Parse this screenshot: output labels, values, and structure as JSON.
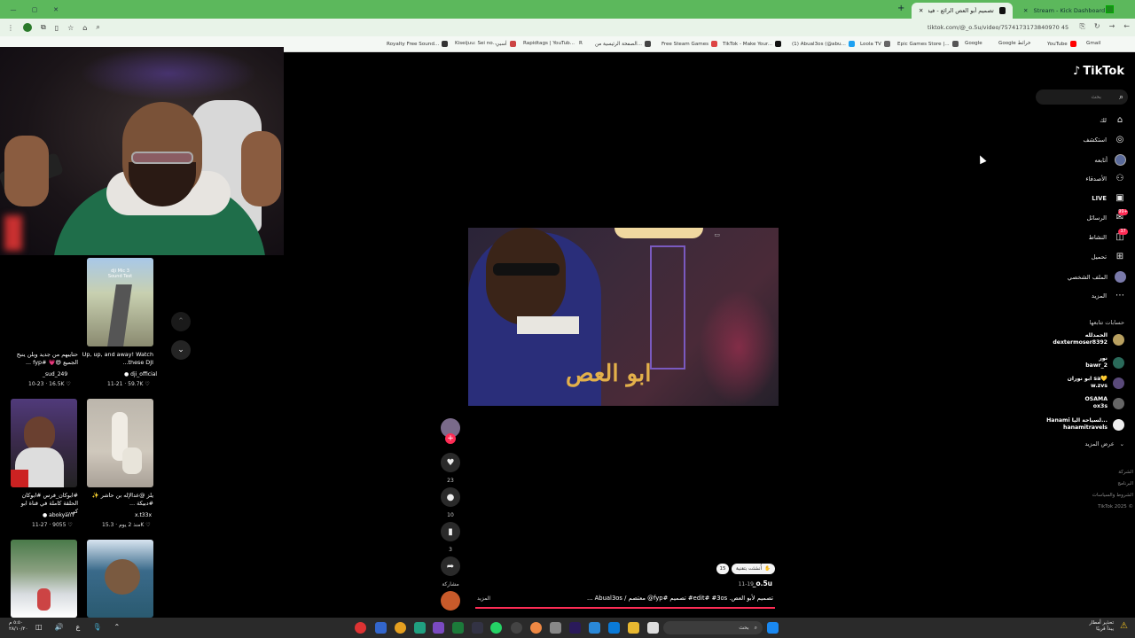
{
  "browser": {
    "tabs": [
      {
        "label": "Stream - Kick Dashboard",
        "active": false
      },
      {
        "label": "تصميم أبو العص الرائع - فيد...",
        "active": true
      }
    ],
    "url": "tiktok.com/@_o.5u/video/7574173173840970 45",
    "bookmarks": [
      "Royalty Free Sound...",
      "Kiseijuu: Sei no...",
      "أسبي",
      "Rapidtags | YouTub...",
      "R",
      "الصفحة الرئيسية من...",
      "Free Steam Games",
      "TikTok - Make Your...",
      "(1) Abual3os (@abu...",
      "Loola TV",
      "Epic Games Store |...",
      "Google",
      "Google خرائط",
      "YouTube",
      "Gmail"
    ]
  },
  "left_videos": [
    {
      "thumb_text": "dji Mic 3 Sound Test",
      "caption": "Up, up, and away! Watch these DJI...",
      "user": "dji_official",
      "date": "11-21",
      "likes": "59.7K",
      "verified": true
    },
    {
      "caption": "حتايبهم من جديد وبلن ينبح الجميع 😄💗 #fyp ...",
      "user": "_sud_249",
      "date": "10-23",
      "likes": "16.5K",
      "verified": false
    },
    {
      "caption": "يلز @عدالإله بن حاشر ✨ #دبيكة ...",
      "user": "x.t33x",
      "date": "منذ 2 يوم",
      "likes": "15.3K",
      "verified": false
    },
    {
      "caption": "#ابوكان_فرس #ابوكان الحلقة كاملة في قناة ابو كي...",
      "user": "abokyan7",
      "date": "11-27",
      "likes": "9055",
      "verified": true
    }
  ],
  "main_video": {
    "overlay_text": "ابو العص",
    "user": "_o.5u",
    "date": "11-19",
    "caption": "تصميم لأبو العص. edit# #3os# تصميم #fyp@ معتصم / Abual3os ...",
    "more_label": "المزيد",
    "chip_label": "أُنشئت بتقنية",
    "chip_badge": "15",
    "likes": "23",
    "comments": "10",
    "saves": "3",
    "share_label": "مشاركة"
  },
  "sidebar": {
    "logo": "TikTok",
    "search_placeholder": "بحث",
    "items": [
      {
        "label": "لك",
        "icon": "home-icon"
      },
      {
        "label": "استكشف",
        "icon": "compass-icon"
      },
      {
        "label": "أتابعه",
        "icon": "following-icon"
      },
      {
        "label": "الأصدقاء",
        "icon": "friends-icon"
      },
      {
        "label": "LIVE",
        "icon": "live-icon"
      },
      {
        "label": "الرسائل",
        "icon": "messages-icon",
        "badge": "99+"
      },
      {
        "label": "النشاط",
        "icon": "activity-icon",
        "badge": "37"
      },
      {
        "label": "تحميل",
        "icon": "upload-icon"
      },
      {
        "label": "الملف الشخصي",
        "icon": "profile-icon"
      },
      {
        "label": "المزيد",
        "icon": "more-icon"
      }
    ],
    "following_title": "حسابات تتابعها",
    "following": [
      {
        "name": "الحمدلله",
        "handle": "dextermoser8392"
      },
      {
        "name": "نور",
        "handle": "bawr_2"
      },
      {
        "name": "ابو نوران sa💛",
        "handle": "w.zvs"
      },
      {
        "name": "OSAMA",
        "handle": "ox3s"
      },
      {
        "name": "Hanami لسياحة اليا...",
        "handle": "hanamitravels"
      }
    ],
    "see_more": "عرض المزيد",
    "footer": [
      "الشركة",
      "البرنامج",
      "الشروط والسياسات",
      "TikTok 2025 ©"
    ]
  },
  "taskbar": {
    "time": "٥:٥٠ م",
    "date": "٢٨/١٠/٢٠",
    "search_placeholder": "بحث",
    "weather_line1": "تحذير أمطار",
    "weather_line2": "يبدأ قريبًا"
  }
}
